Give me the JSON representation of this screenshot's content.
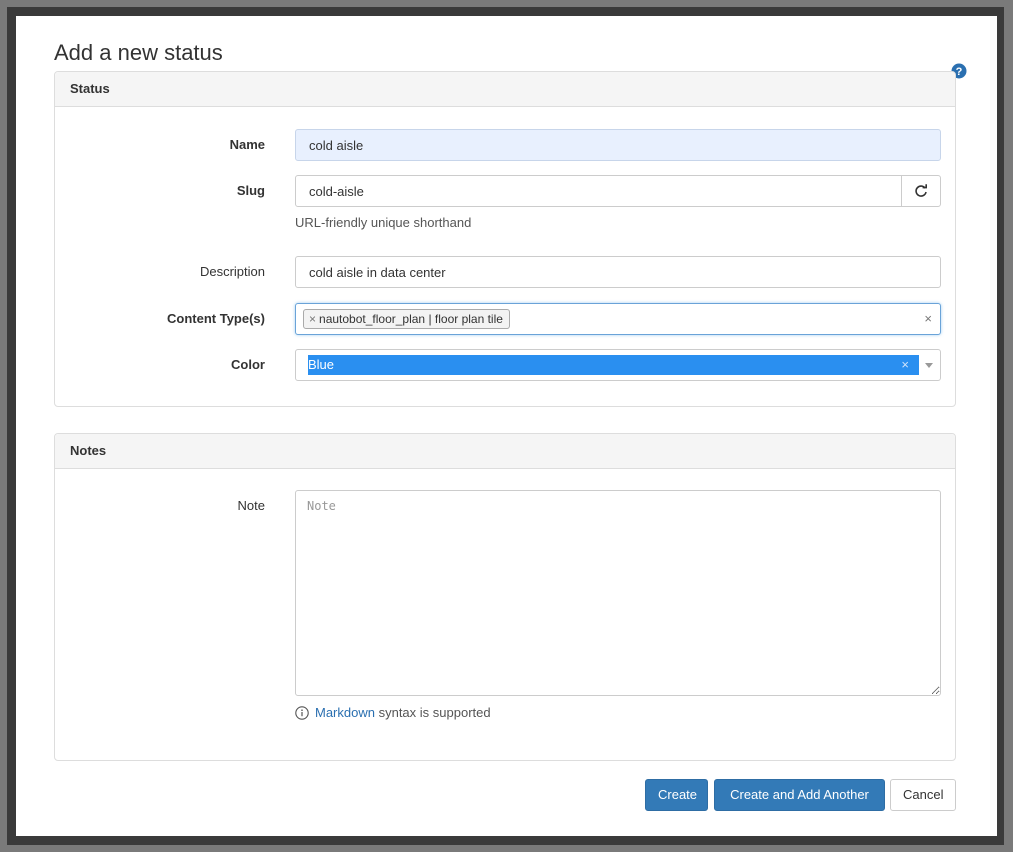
{
  "page": {
    "title": "Add a new status"
  },
  "status_panel": {
    "heading": "Status",
    "name": {
      "label": "Name",
      "value": "cold aisle"
    },
    "slug": {
      "label": "Slug",
      "value": "cold-aisle",
      "help": "URL-friendly unique shorthand"
    },
    "description": {
      "label": "Description",
      "value": "cold aisle in data center"
    },
    "content_types": {
      "label": "Content Type(s)",
      "tags": [
        "nautobot_floor_plan | floor plan tile"
      ],
      "tag_remove": "×",
      "clear": "×"
    },
    "color": {
      "label": "Color",
      "value": "Blue",
      "clear": "×",
      "highlight": "#2a8ff0"
    }
  },
  "notes_panel": {
    "heading": "Notes",
    "note": {
      "label": "Note",
      "value": "",
      "placeholder": "Note"
    },
    "markdown_link": "Markdown",
    "markdown_suffix": "syntax is supported"
  },
  "actions": {
    "create": "Create",
    "create_another": "Create and Add Another",
    "cancel": "Cancel"
  },
  "icons": {
    "help": "question-circle-icon",
    "refresh": "refresh-icon",
    "info": "info-circle-icon"
  },
  "colors": {
    "primary": "#337ab7",
    "link": "#2a6fb0"
  }
}
